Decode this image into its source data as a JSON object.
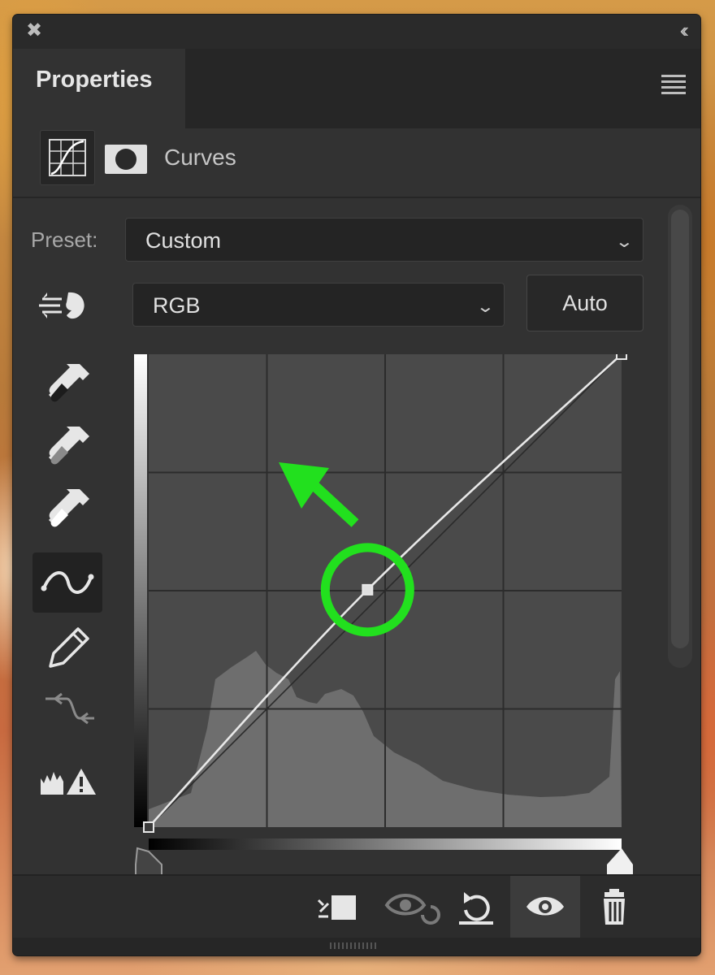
{
  "panel": {
    "tab_title": "Properties",
    "adjustment_name": "Curves"
  },
  "preset": {
    "label": "Preset:",
    "value": "Custom"
  },
  "channel": {
    "value": "RGB"
  },
  "buttons": {
    "auto_label": "Auto"
  },
  "icons": {
    "close": "close-icon",
    "collapse": "double-chevron-left-icon",
    "panel_menu": "hamburger-menu-icon",
    "adjustment": "curves-adjustment-icon",
    "mask": "layer-mask-icon",
    "on_image": "on-image-adjustment-icon",
    "tools": [
      "black-point-eyedropper-icon",
      "gray-point-eyedropper-icon",
      "white-point-eyedropper-icon",
      "point-curve-tool-icon",
      "pencil-draw-icon",
      "smooth-curve-icon",
      "clipping-warning-icon"
    ],
    "footer": [
      "clip-to-layer-icon",
      "view-previous-state-icon",
      "reset-icon",
      "toggle-visibility-icon",
      "delete-icon"
    ]
  },
  "curve": {
    "input_max": 255,
    "output_max": 255,
    "points": [
      [
        0,
        0
      ],
      [
        118,
        128
      ],
      [
        255,
        255
      ]
    ],
    "selected_point": [
      118,
      128
    ]
  },
  "colors": {
    "panel_bg": "#323232",
    "annotation_green": "#22e01e",
    "histogram": "#6e6e6e",
    "graph_bg": "#4a4a4a"
  }
}
